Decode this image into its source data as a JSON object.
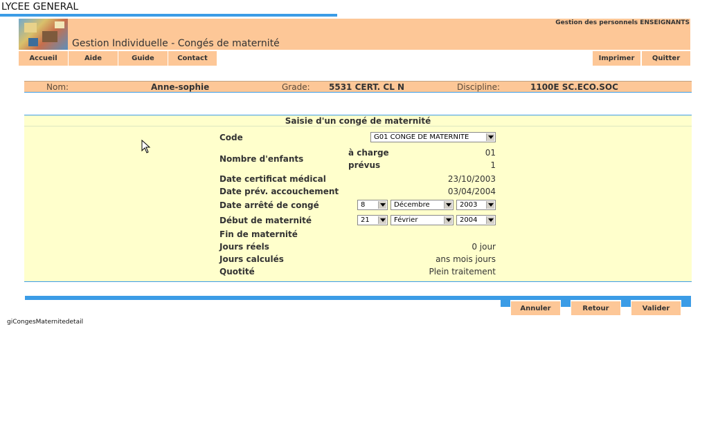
{
  "site_title": "LYCEE GENERAL",
  "header": {
    "page_title": "Gestion Individuelle - Congés de maternité",
    "section_title": "Gestion des personnels ENSEIGNANTS"
  },
  "nav": {
    "left": [
      "Accueil",
      "Aide",
      "Guide",
      "Contact"
    ],
    "right": [
      "Imprimer",
      "Quitter"
    ]
  },
  "identity": {
    "nom_label": "Nom:",
    "nom_value": "Anne-sophie",
    "grade_label": "Grade:",
    "grade_value": "5531 CERT. CL N",
    "discipline_label": "Discipline:",
    "discipline_value": "1100E SC.ECO.SOC"
  },
  "form": {
    "title": "Saisie d'un congé de maternité",
    "code_label": "Code",
    "code_value": "G01 CONGE DE MATERNITE",
    "nb_enfants_label": "Nombre d'enfants",
    "a_charge_label": "à charge",
    "a_charge_value": "01",
    "prevus_label": "prévus",
    "prevus_value": "1",
    "date_certificat_label": "Date certificat médical",
    "date_certificat_value": "23/10/2003",
    "date_accouchement_label": "Date prév. accouchement",
    "date_accouchement_value": "03/04/2004",
    "date_arrete_label": "Date arrêté de congé",
    "date_arrete": {
      "day": "8",
      "month": "Décembre",
      "year": "2003"
    },
    "debut_label": "Début de maternité",
    "debut": {
      "day": "21",
      "month": "Février",
      "year": "2004"
    },
    "fin_label": "Fin de maternité",
    "jours_reels_label": "Jours réels",
    "jours_reels_value": "0 jour",
    "jours_calcules_label": "Jours calculés",
    "jours_calcules_value": "ans mois jours",
    "quotite_label": "Quotité",
    "quotite_value": "Plein traitement"
  },
  "actions": [
    "Annuler",
    "Retour",
    "Valider"
  ],
  "page_code": "giCongesMaternitedetail",
  "colors": {
    "accent_blue": "#3b9ce6",
    "header_orange": "#fdc797",
    "form_yellow": "#ffffcc"
  }
}
